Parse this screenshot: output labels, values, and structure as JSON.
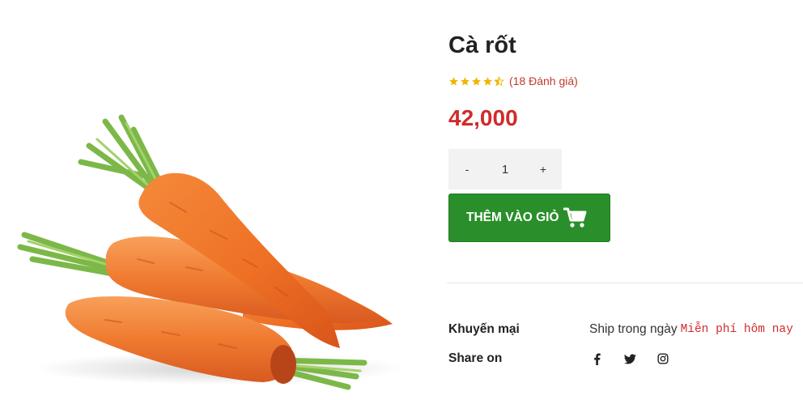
{
  "product": {
    "image_alt": "Cà rốt",
    "title": "Cà rốt",
    "rating": 4.5,
    "rating_label": "(18 Đánh giá)",
    "price": "42,000",
    "quantity": {
      "minus": "-",
      "value": "1",
      "plus": "+"
    },
    "add_to_cart_label": "THÊM VÀO GIỎ",
    "promo": {
      "label": "Khuyến mại",
      "text": "Ship trong ngày",
      "highlight": "Miễn phí hôm nay"
    },
    "share": {
      "label": "Share on",
      "icons": [
        "facebook-icon",
        "twitter-icon",
        "instagram-icon"
      ]
    }
  },
  "colors": {
    "price": "#d12b2b",
    "rating_star": "#f0b400",
    "rating_count": "#c0392b",
    "cart_button": "#2a8f2a",
    "qty_background": "#f2f2f2"
  }
}
